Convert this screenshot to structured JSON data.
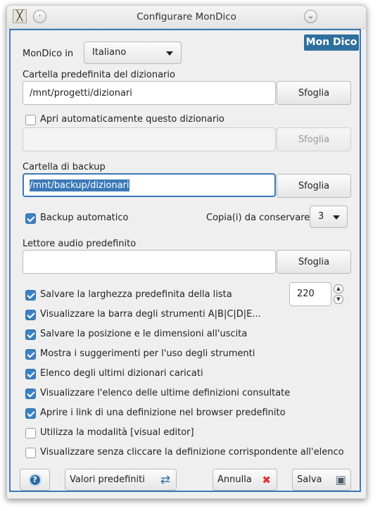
{
  "window": {
    "title": "Configurare MonDico",
    "app_icon": "╳",
    "minimize_glyph": "·",
    "menu_glyph": "⌄"
  },
  "logo_text": "Mon Dico",
  "language": {
    "label": "MonDico in",
    "value": "Italiano"
  },
  "dict_folder": {
    "label": "Cartella predefinita del dizionario",
    "value": "/mnt/progetti/dizionari",
    "browse": "Sfoglia"
  },
  "auto_open": {
    "label": "Apri automaticamente questo dizionario",
    "checked": false,
    "value": "",
    "browse": "Sfoglia"
  },
  "backup_folder": {
    "label": "Cartella di backup",
    "value": "/mnt/backup/dizionari",
    "browse": "Sfoglia"
  },
  "auto_backup": {
    "label": "Backup automatico",
    "checked": true
  },
  "copies": {
    "label": "Copia(i) da conservare",
    "value": "3"
  },
  "audio_player": {
    "label": "Lettore audio predefinito",
    "value": "",
    "browse": "Sfoglia"
  },
  "list_width": {
    "value": "220",
    "up": "▲",
    "down": "▼"
  },
  "options": [
    {
      "label": "Salvare la larghezza predefinita della lista",
      "checked": true
    },
    {
      "label": "Visualizzare la barra degli strumenti A|B|C|D|E...",
      "checked": true
    },
    {
      "label": "Salvare la posizione e le dimensioni all'uscita",
      "checked": true
    },
    {
      "label": "Mostra i suggerimenti per l'uso degli strumenti",
      "checked": true
    },
    {
      "label": "Elenco degli ultimi dizionari caricati",
      "checked": true
    },
    {
      "label": "Visualizzare l'elenco delle ultime definizioni consultate",
      "checked": true
    },
    {
      "label": "Aprire i link di una definizione nel browser predefinito",
      "checked": true
    },
    {
      "label": "Utilizza la modalità [visual editor]",
      "checked": false
    },
    {
      "label": "Visualizzare senza cliccare la definizione corrispondente all'elenco",
      "checked": false
    }
  ],
  "footer": {
    "help_glyph": "?",
    "defaults_label": "Valori predefiniti",
    "defaults_glyph": "⇄",
    "cancel_label": "Annulla",
    "cancel_glyph": "✖",
    "save_label": "Salva",
    "save_glyph": "▣"
  },
  "colors": {
    "accent": "#3a79b8",
    "cancel": "#e03030"
  }
}
